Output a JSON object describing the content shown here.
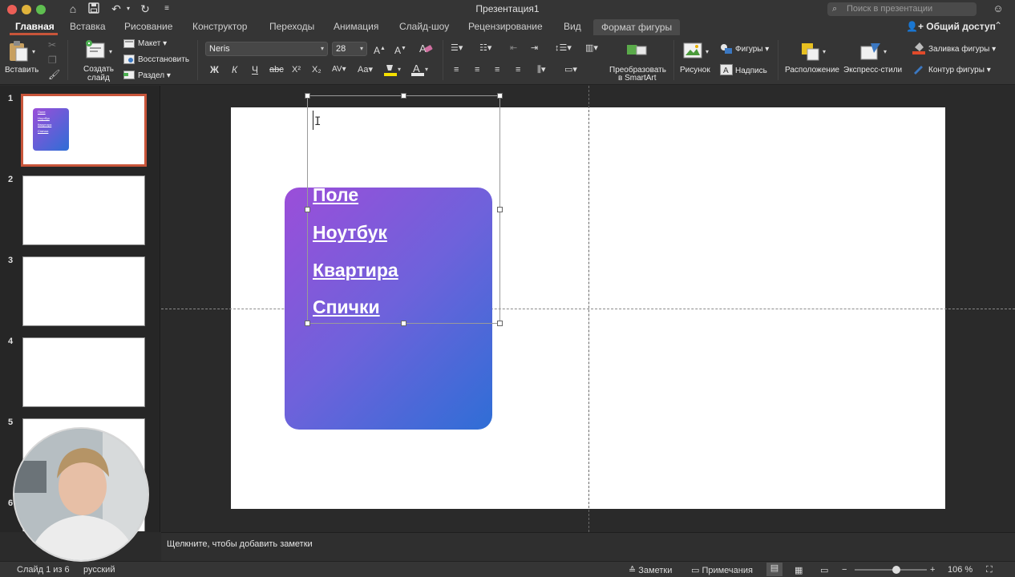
{
  "window": {
    "title": "Презентация1",
    "search_placeholder": "Поиск в презентации"
  },
  "tabs": [
    "Главная",
    "Вставка",
    "Рисование",
    "Конструктор",
    "Переходы",
    "Анимация",
    "Слайд-шоу",
    "Рецензирование",
    "Вид",
    "Формат фигуры"
  ],
  "share_label": "Общий доступ",
  "ribbon": {
    "paste": "Вставить",
    "new_slide_line1": "Создать",
    "new_slide_line2": "слайд",
    "layout": "Макет",
    "reset": "Восстановить",
    "section": "Раздел",
    "font_name": "Neris",
    "font_size": "28",
    "bold": "Ж",
    "italic": "К",
    "underline": "Ч",
    "strike": "abc",
    "superscript": "X²",
    "subscript": "X₂",
    "smartart_line1": "Преобразовать",
    "smartart_line2": "в SmartArt",
    "picture": "Рисунок",
    "shapes": "Фигуры",
    "textbox": "Надпись",
    "arrange": "Расположение",
    "quick_styles": "Экспресс-стили",
    "shape_fill": "Заливка фигуры",
    "shape_outline": "Контур фигуры"
  },
  "slides": [
    "1",
    "2",
    "3",
    "4",
    "5",
    "6"
  ],
  "thumb1_links": [
    "Поле",
    "Ноутбук",
    "Квартира",
    "Спички"
  ],
  "slide_links": [
    "Поле",
    "Ноутбук",
    "Квартира",
    "Спички"
  ],
  "notes_placeholder": "Щелкните, чтобы добавить заметки",
  "status": {
    "slide_counter": "Слайд 1 из 6",
    "language": "русский",
    "notes_btn": "Заметки",
    "comments_btn": "Примечания",
    "zoom_minus": "−",
    "zoom_plus": "+",
    "zoom": "106 %",
    "zoom_fraction": 0.58
  },
  "colors": {
    "accent": "#c8553a",
    "gradient_start": "#9b4ed9",
    "gradient_end": "#2f6ed6"
  }
}
